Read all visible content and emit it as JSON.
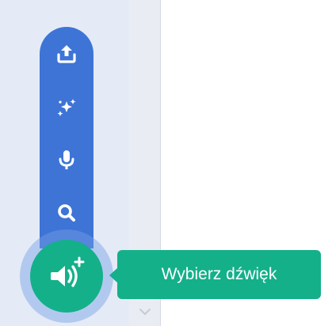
{
  "sound_menu": {
    "items": [
      {
        "icon": "upload-icon"
      },
      {
        "icon": "surprise-sparkle-icon"
      },
      {
        "icon": "microphone-icon"
      },
      {
        "icon": "search-icon"
      }
    ],
    "main_button_icon": "add-sound-icon",
    "tooltip_text": "Wybierz dźwięk"
  },
  "colors": {
    "menu_blue": "#3d74d6",
    "action_green": "#14b08a",
    "pane_background": "#e4ebf6"
  }
}
